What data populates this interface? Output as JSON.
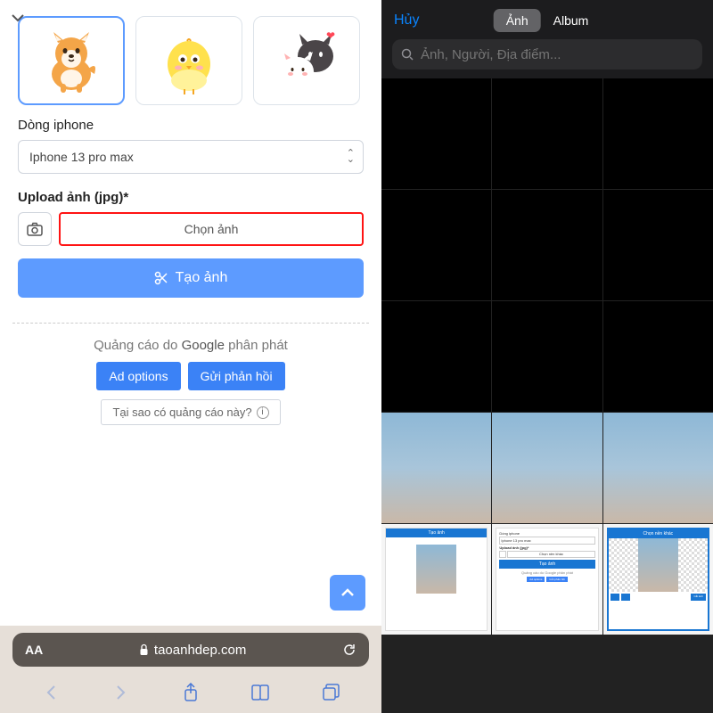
{
  "left": {
    "iphone_label": "Dòng iphone",
    "iphone_value": "Iphone 13 pro max",
    "upload_label": "Upload ảnh (jpg)*",
    "choose_label": "Chọn ảnh",
    "create_label": "Tạo ảnh",
    "ad_prefix": "Quảng cáo do ",
    "ad_google": "Google",
    "ad_suffix": " phân phát",
    "ad_options": "Ad options",
    "ad_feedback": "Gửi phản hồi",
    "ad_why": "Tại sao có quảng cáo này?",
    "url_text": "taoanhdep.com",
    "aa": "AA"
  },
  "right": {
    "cancel": "Hủy",
    "tab_photos": "Ảnh",
    "tab_albums": "Album",
    "search_placeholder": "Ảnh, Người, Địa điểm...",
    "mini": {
      "tao_anh": "Tạo ảnh",
      "dong": "Dòng iphone",
      "iphone": "Iphone 13 pro max",
      "upload": "Upload ảnh (jpg)*",
      "chon_nen": "Chọn nền khác",
      "quang_cao": "Quảng cáo do Google phân phát",
      "ad_opt": "Ad options",
      "gui": "Gửi phản hồi",
      "cat": "Cắt ảnh"
    }
  }
}
